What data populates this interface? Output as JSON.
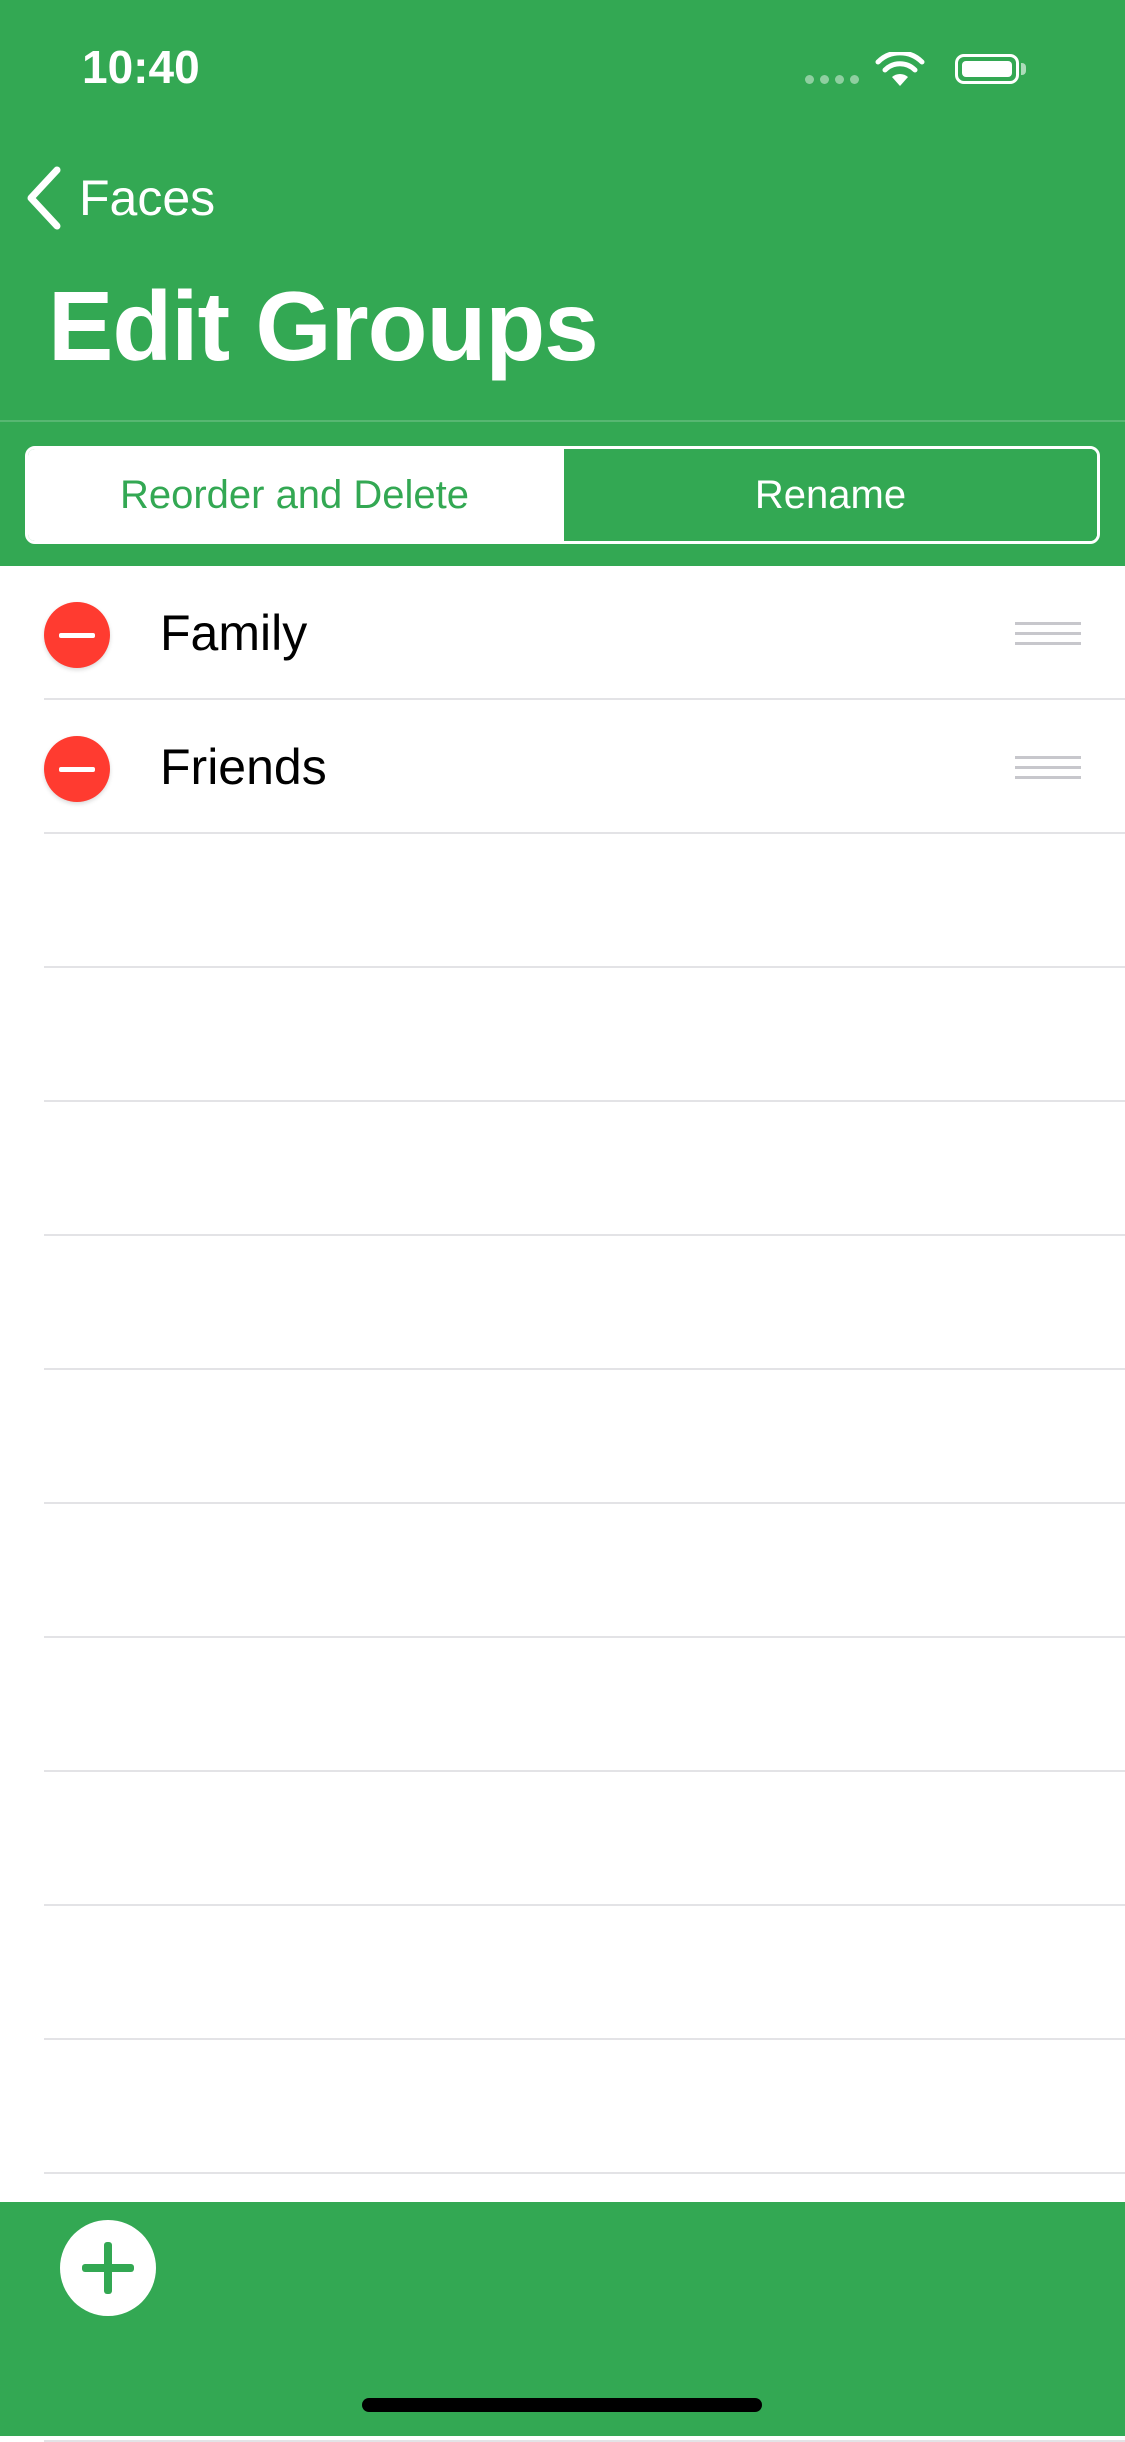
{
  "status_bar": {
    "time": "10:40",
    "icons": [
      "signal-icon",
      "wifi-icon",
      "battery-icon"
    ]
  },
  "nav": {
    "back_label": "Faces",
    "title": "Edit Groups"
  },
  "segmented_control": {
    "segments": [
      {
        "label": "Reorder and Delete",
        "selected": true
      },
      {
        "label": "Rename",
        "selected": false
      }
    ]
  },
  "groups": [
    {
      "label": "Family"
    },
    {
      "label": "Friends"
    }
  ],
  "toolbar": {
    "add_icon": "plus-icon"
  },
  "colors": {
    "accent": "#33a853",
    "delete": "#ff3b30",
    "separator": "#e3e3e6"
  }
}
